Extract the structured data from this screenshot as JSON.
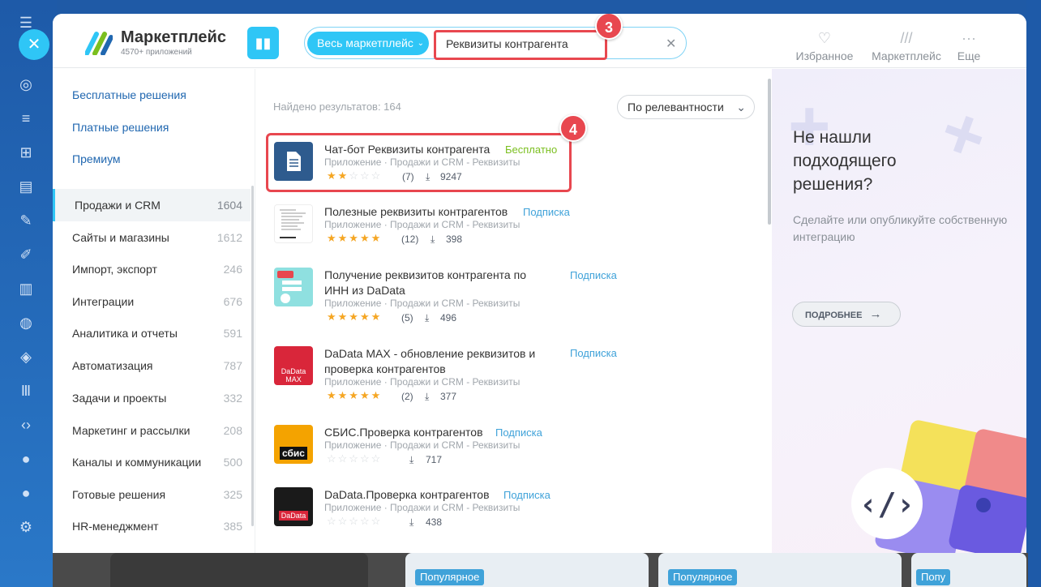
{
  "header": {
    "app_title": "Маркетплейс",
    "app_subtitle": "4570+ приложений",
    "search_scope": "Весь маркетплейс",
    "search_query": "Реквизиты контрагента",
    "nav": [
      {
        "label": "Избранное",
        "icon": "heart-icon"
      },
      {
        "label": "Маркетплейс",
        "icon": "marketplace-icon"
      },
      {
        "label": "Еще",
        "icon": "more-icon"
      }
    ]
  },
  "annotations": {
    "step3": "3",
    "step4": "4"
  },
  "sidebar": {
    "links": [
      "Бесплатные решения",
      "Платные решения",
      "Премиум"
    ],
    "categories": [
      {
        "label": "Продажи и CRM",
        "count": "1604"
      },
      {
        "label": "Сайты и магазины",
        "count": "1612"
      },
      {
        "label": "Импорт, экспорт",
        "count": "246"
      },
      {
        "label": "Интеграции",
        "count": "676"
      },
      {
        "label": "Аналитика и отчеты",
        "count": "591"
      },
      {
        "label": "Автоматизация",
        "count": "787"
      },
      {
        "label": "Задачи и проекты",
        "count": "332"
      },
      {
        "label": "Маркетинг и рассылки",
        "count": "208"
      },
      {
        "label": "Каналы и коммуникации",
        "count": "500"
      },
      {
        "label": "Готовые решения",
        "count": "325"
      },
      {
        "label": "HR-менеджмент",
        "count": "385"
      }
    ]
  },
  "results": {
    "found": "Найдено результатов: 164",
    "sort": "По релевантности",
    "items": [
      {
        "title": "Чат-бот Реквизиты контрагента",
        "tag": "Бесплатно",
        "meta": "Приложение · Продажи и CRM - Реквизиты",
        "rating": "(7)",
        "installs": "9247"
      },
      {
        "title": "Полезные реквизиты контрагентов",
        "tag": "Подписка",
        "meta": "Приложение · Продажи и CRM - Реквизиты",
        "rating": "(12)",
        "installs": "398"
      },
      {
        "title": "Получение реквизитов контрагента по ИНН из DaData",
        "tag": "Подписка",
        "meta": "Приложение · Продажи и CRM - Реквизиты",
        "rating": "(5)",
        "installs": "496"
      },
      {
        "title": "DaData MAX - обновление реквизитов и проверка контрагентов",
        "tag": "Подписка",
        "meta": "Приложение · Продажи и CRM - Реквизиты",
        "rating": "(2)",
        "installs": "377"
      },
      {
        "title": "СБИС.Проверка контрагентов",
        "tag": "Подписка",
        "meta": "Приложение · Продажи и CRM - Реквизиты",
        "rating": "",
        "installs": "717"
      },
      {
        "title": "DaData.Проверка контрагентов",
        "tag": "Подписка",
        "meta": "Приложение · Продажи и CRM - Реквизиты",
        "rating": "",
        "installs": "438"
      }
    ],
    "icon_labels": {
      "dadata": "DaData",
      "dadata_max": "DaData MAX",
      "sbis": "сбис"
    }
  },
  "promo": {
    "heading": "Не нашли подходящего решения?",
    "text": "Сделайте или опубликуйте собственную интеграцию",
    "button": "ПОДРОБНЕЕ"
  },
  "background": {
    "popular": "Популярное",
    "popular_cut": "Попу"
  },
  "colors": {
    "accent": "#2fc6f6",
    "highlight": "#e8474f",
    "link": "#2067b0",
    "free": "#7bbf1f",
    "subscription": "#3fa2d9",
    "star": "#f5a623"
  }
}
